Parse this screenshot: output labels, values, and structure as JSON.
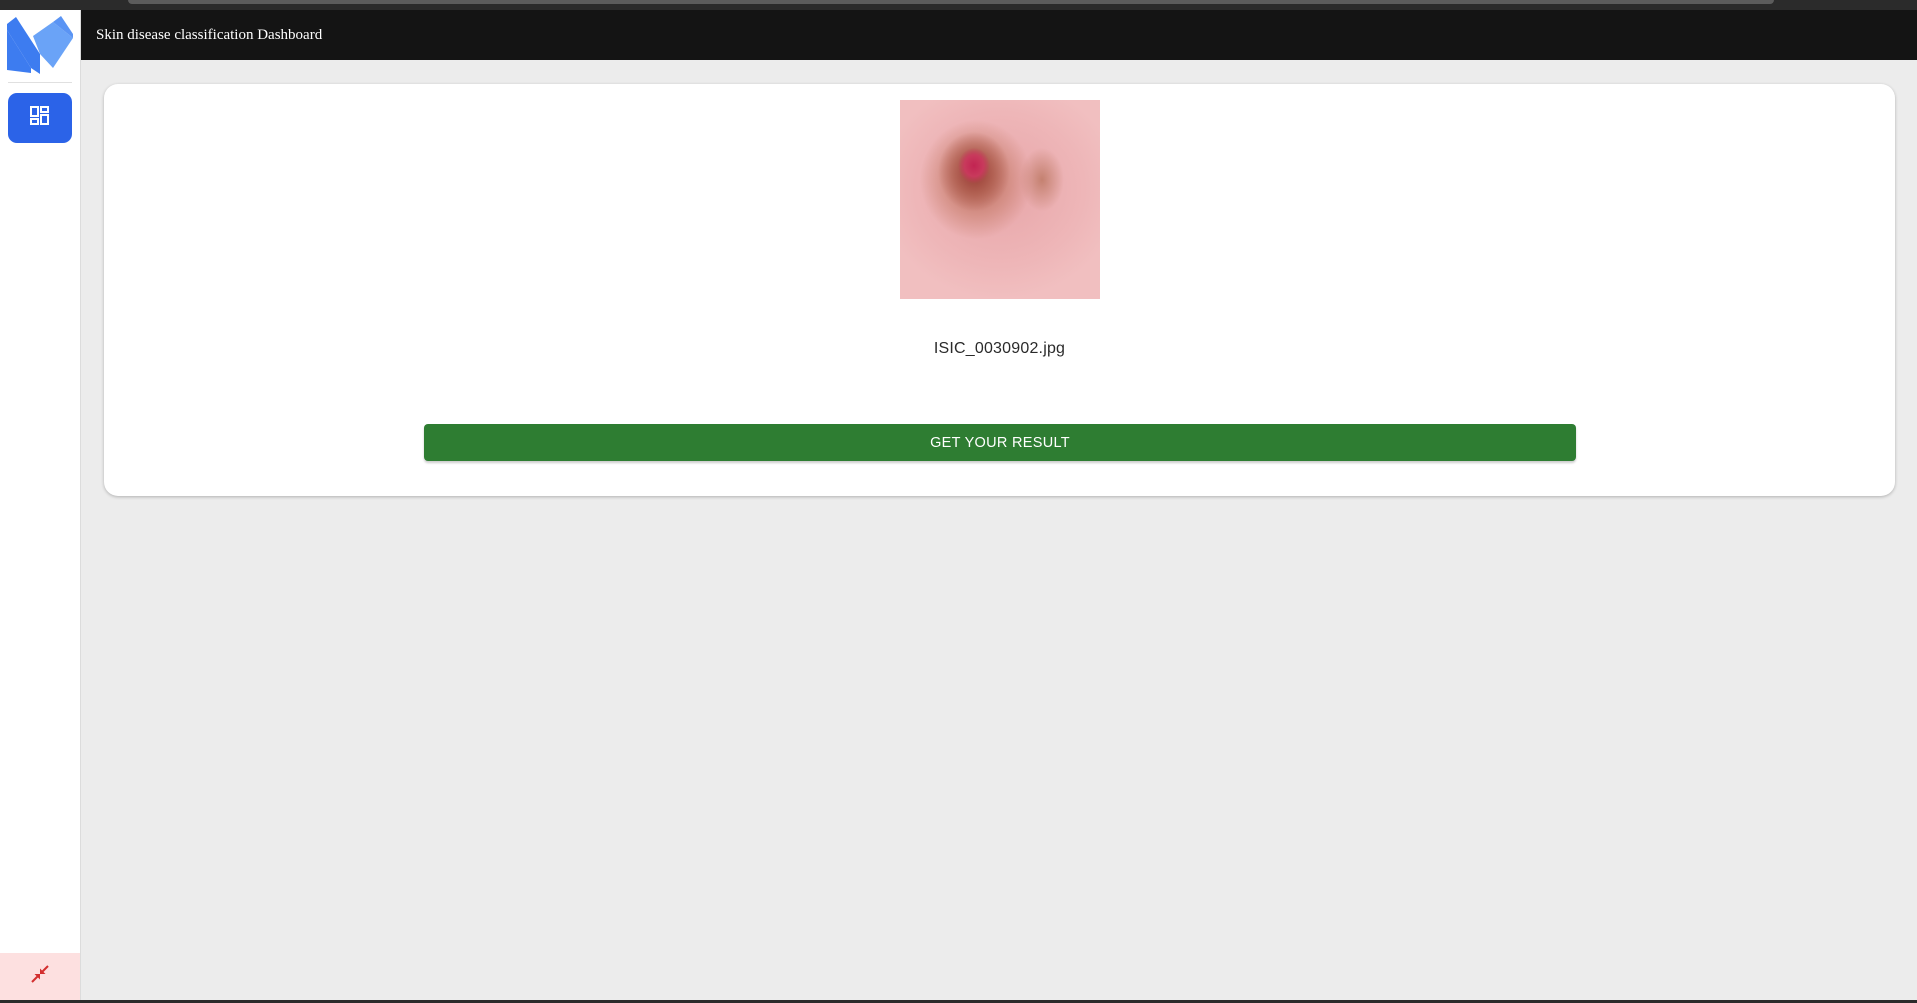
{
  "app": {
    "title": "Skin disease classification Dashboard"
  },
  "sidebar": {
    "logo_icon": "m-logo-icon",
    "nav_items": [
      {
        "icon": "dashboard-icon",
        "active": true
      }
    ],
    "collapse_icon": "collapse-arrows-icon"
  },
  "main": {
    "upload": {
      "filename": "ISIC_0030902.jpg",
      "result_button_label": "GET YOUR RESULT"
    }
  },
  "colors": {
    "appbar": "#141414",
    "nav_active": "#2b63e8",
    "logo_primary": "#3d7cf0",
    "logo_secondary": "#6aa3f7",
    "result_button": "#2e7d32",
    "collapse_bg": "#fde0e0",
    "collapse_icon": "#d32f2f"
  }
}
